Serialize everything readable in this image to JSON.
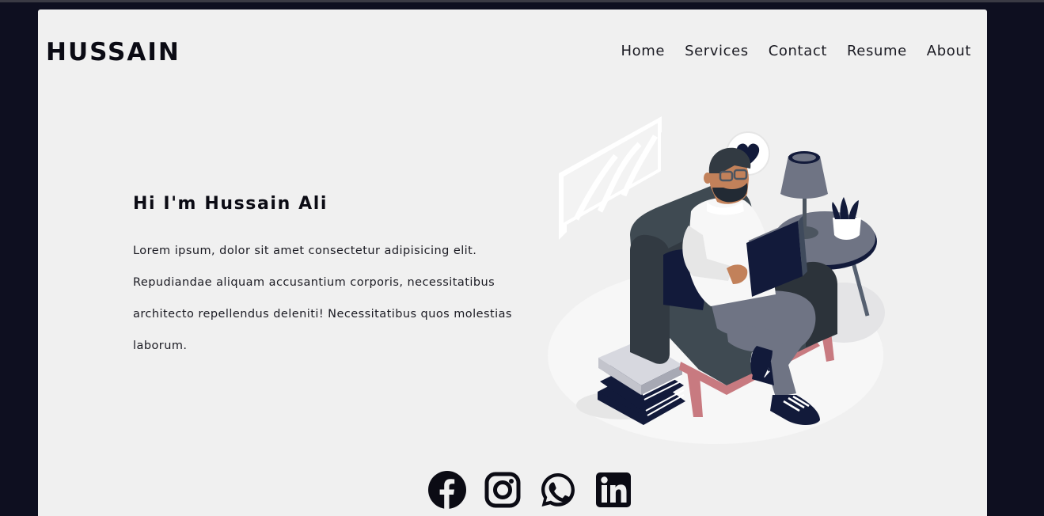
{
  "brand": {
    "name": "HUSSAIN"
  },
  "nav": {
    "items": [
      {
        "label": "Home"
      },
      {
        "label": "Services"
      },
      {
        "label": "Contact"
      },
      {
        "label": "Resume"
      },
      {
        "label": "About"
      }
    ]
  },
  "hero": {
    "title": "Hi I'm Hussain Ali",
    "line1": "Lorem ipsum, dolor sit amet consectetur adipisicing elit.",
    "line2": "Repudiandae aliquam accusantium corporis, necessitatibus",
    "line3": "architecto repellendus deleniti! Necessitatibus quos molestias",
    "line4": "laborum."
  },
  "socials": [
    {
      "icon": "facebook-icon"
    },
    {
      "icon": "instagram-icon"
    },
    {
      "icon": "whatsapp-icon"
    },
    {
      "icon": "linkedin-icon"
    }
  ],
  "colors": {
    "page_background": "#0e0f20",
    "card_background": "#f0f0f0",
    "text_primary": "#0b0b14",
    "accent_navy": "#121a3a"
  }
}
